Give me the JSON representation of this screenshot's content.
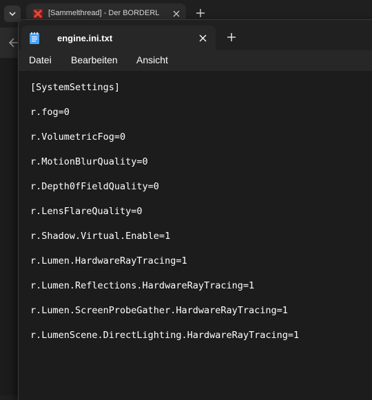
{
  "browser": {
    "tab_title": "[Sammelthread] - Der BORDERL",
    "icons": {
      "tab_dropdown": "chevron-down-icon",
      "favicon": "site-favicon-icon",
      "close": "close-icon",
      "new_tab": "plus-icon",
      "back": "back-arrow-icon"
    }
  },
  "notepad": {
    "tab_title": "engine.ini.txt",
    "menu": [
      "Datei",
      "Bearbeiten",
      "Ansicht"
    ],
    "lines": [
      "[SystemSettings]",
      "r.fog=0",
      "r.VolumetricFog=0",
      "r.MotionBlurQuality=0",
      "r.Depth0fFieldQuality=0",
      "r.LensFlareQuality=0",
      "r.Shadow.Virtual.Enable=1",
      "r.Lumen.HardwareRayTracing=1",
      "r.Lumen.Reflections.HardwareRayTracing=1",
      "r.Lumen.ScreenProbeGather.HardwareRayTracing=1",
      "r.LumenScene.DirectLighting.HardwareRayTracing=1"
    ],
    "icons": {
      "file": "notepad-file-icon",
      "close": "close-icon",
      "new_tab": "plus-icon"
    }
  },
  "colors": {
    "background": "#1c1c1c",
    "text": "#ffffff",
    "accent": "#4aa3ff",
    "favicon": "#c0392b"
  }
}
